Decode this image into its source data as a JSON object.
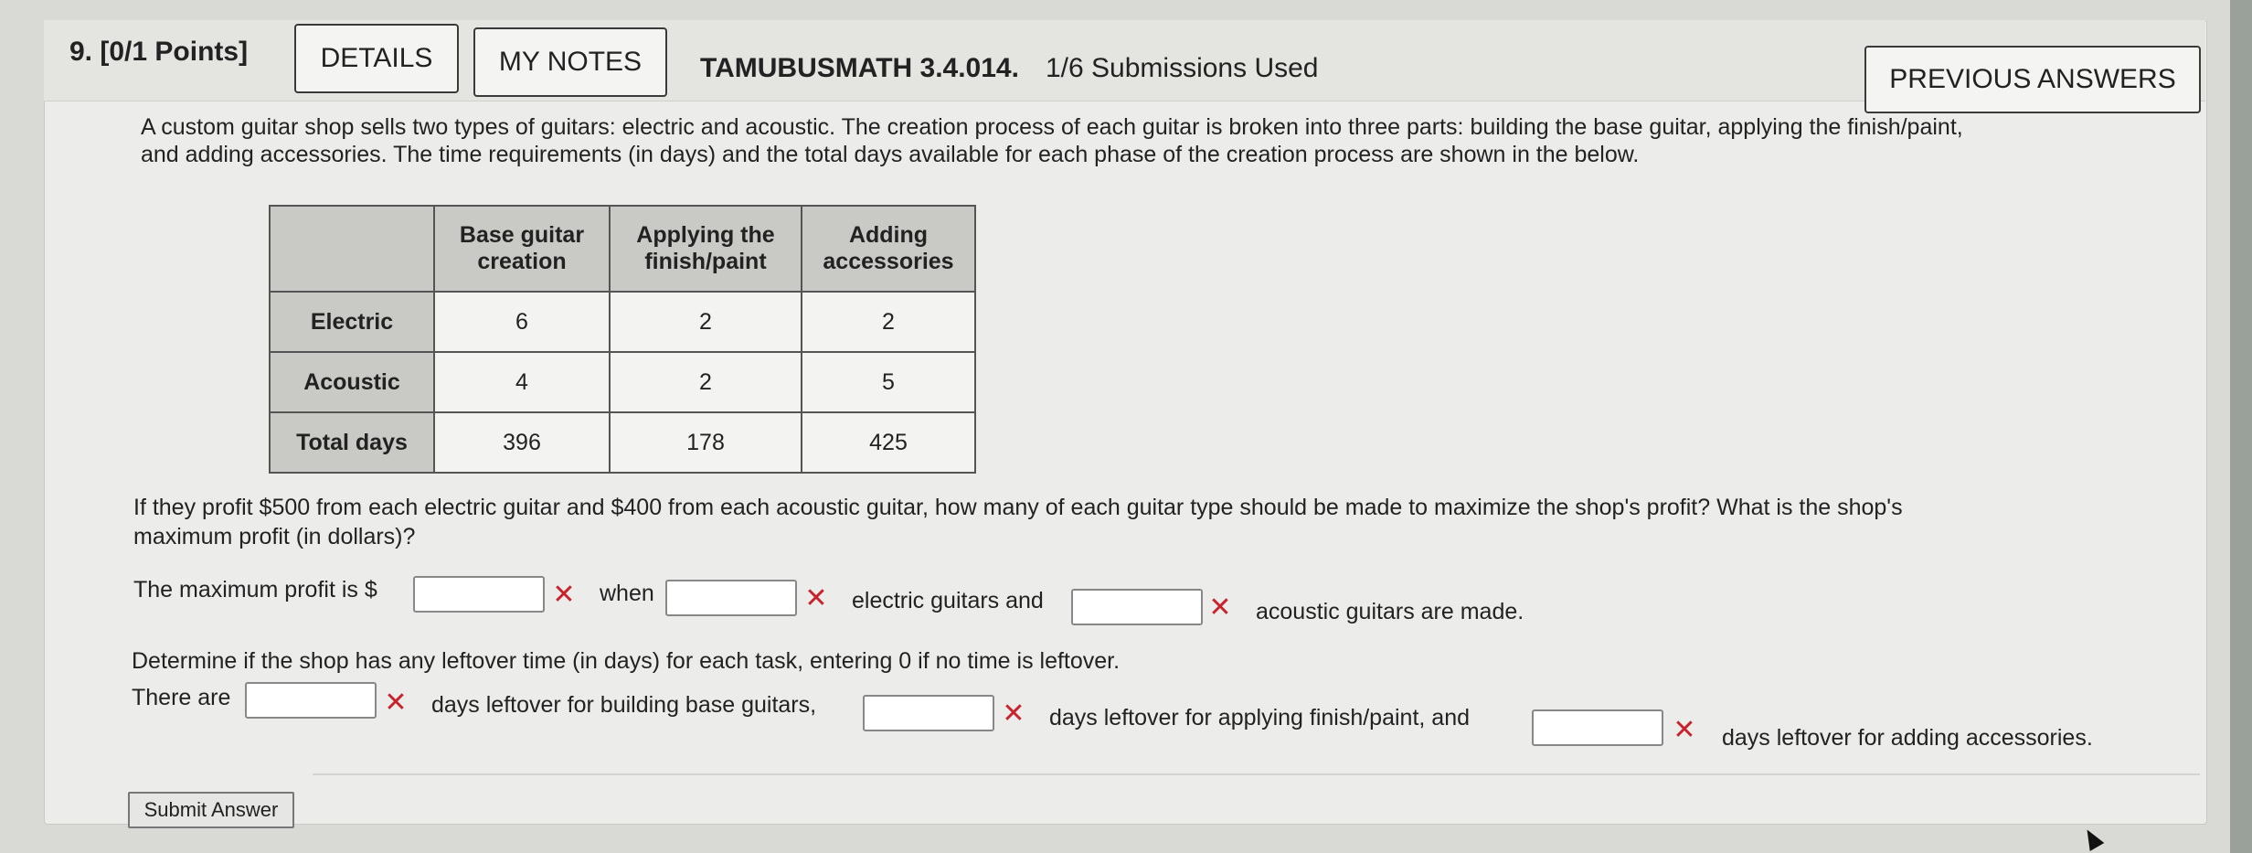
{
  "header": {
    "question_number": "9.",
    "points": "[0/1 Points]",
    "details_label": "DETAILS",
    "mynotes_label": "MY NOTES",
    "assignment_id": "TAMUBUSMATH 3.4.014.",
    "submissions": "1/6 Submissions Used",
    "previous_answers_label": "PREVIOUS ANSWERS"
  },
  "problem": {
    "line1": "A custom guitar shop sells two types of guitars: electric and acoustic. The creation process of each guitar is broken into three parts: building the base guitar, applying the finish/paint,",
    "line2": "and adding accessories. The time requirements (in days) and the total days available for each phase of the creation process are shown in the below."
  },
  "table": {
    "headers": [
      "",
      [
        "Base guitar",
        "creation"
      ],
      [
        "Applying the",
        "finish/paint"
      ],
      [
        "Adding",
        "accessories"
      ]
    ],
    "rows": [
      {
        "label": "Electric",
        "values": [
          "6",
          "2",
          "2"
        ]
      },
      {
        "label": "Acoustic",
        "values": [
          "4",
          "2",
          "5"
        ]
      },
      {
        "label": "Total days",
        "values": [
          "396",
          "178",
          "425"
        ]
      }
    ]
  },
  "question": {
    "line1": "If they profit $500 from each electric guitar and $400 from each acoustic guitar, how many of each guitar type should be made to maximize the shop's profit? What is the shop's",
    "line2": "maximum profit (in dollars)?"
  },
  "answer_row1": {
    "prefix": "The maximum profit is $",
    "when": "when",
    "electric": "electric guitars and",
    "acoustic": "acoustic guitars are made."
  },
  "leftover": {
    "prompt": "Determine if the shop has any leftover time (in days) for each task, entering 0 if no time is leftover.",
    "there_are": "There are",
    "base": "days leftover for building base guitars,",
    "finish": "days leftover for applying finish/paint, and",
    "accessories": "days leftover for adding accessories."
  },
  "submit_label": "Submit Answer",
  "colors": {
    "error_x": "#c8232c",
    "header_bg": "#e4e4e1",
    "table_head_bg": "#c9c9c6"
  }
}
